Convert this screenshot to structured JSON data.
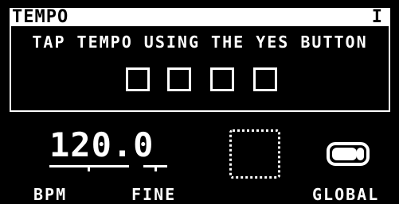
{
  "header": {
    "title": "TEMPO",
    "page_indicator": "I"
  },
  "panel": {
    "instruction": "TAP TEMPO USING THE YES BUTTON",
    "tap_count_total": 4,
    "tap_count_registered": 0
  },
  "controls": {
    "bpm": {
      "value": "120.0",
      "label": "BPM"
    },
    "fine": {
      "label": "FINE"
    },
    "empty_slot": {
      "icon": "dotted-empty-slot-icon"
    },
    "global": {
      "label": "GLOBAL",
      "icon": "toggle-switch-icon",
      "state": "on"
    }
  },
  "colors": {
    "background": "#000000",
    "foreground": "#ffffff"
  }
}
